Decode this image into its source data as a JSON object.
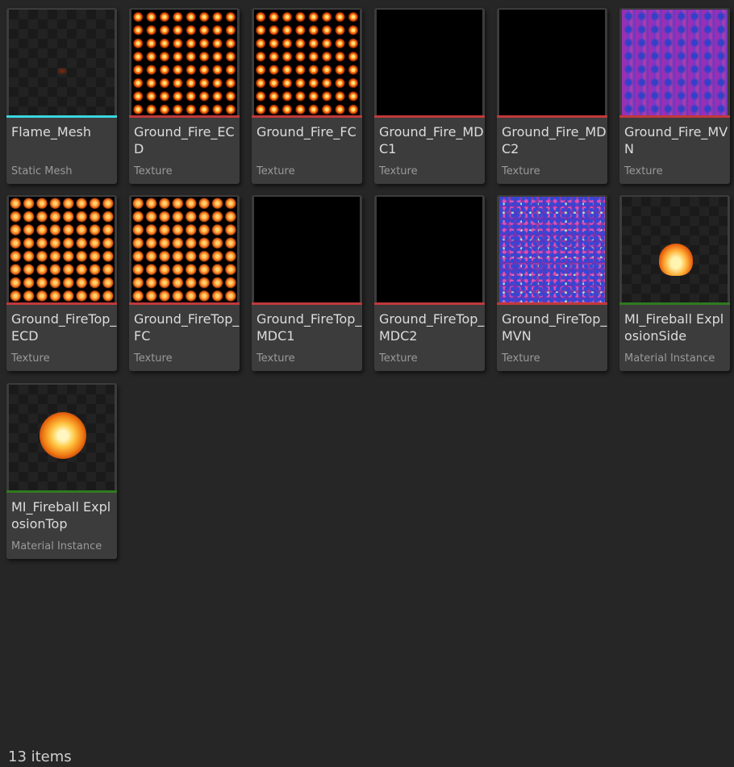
{
  "colors": {
    "background": "#262626",
    "tile": "#3c3c3c",
    "static_mesh_bar": "#3ad6e0",
    "texture_bar": "#c0393b",
    "material_instance_bar": "#2f7a1f"
  },
  "assets": [
    {
      "name": "Flame_Mesh",
      "type": "Static Mesh",
      "thumbnail": "flame-mesh-preview"
    },
    {
      "name": "Ground_Fire_ECD",
      "type": "Texture",
      "thumbnail": "fire-flipbook"
    },
    {
      "name": "Ground_Fire_FC",
      "type": "Texture",
      "thumbnail": "fire-flipbook"
    },
    {
      "name": "Ground_Fire_MDC1",
      "type": "Texture",
      "thumbnail": "black"
    },
    {
      "name": "Ground_Fire_MDC2",
      "type": "Texture",
      "thumbnail": "black"
    },
    {
      "name": "Ground_Fire_MVN",
      "type": "Texture",
      "thumbnail": "motion-vector-flipbook"
    },
    {
      "name": "Ground_FireTop_ECD",
      "type": "Texture",
      "thumbnail": "fire-top-flipbook"
    },
    {
      "name": "Ground_FireTop_FC",
      "type": "Texture",
      "thumbnail": "fire-top-flipbook"
    },
    {
      "name": "Ground_FireTop_MDC1",
      "type": "Texture",
      "thumbnail": "black"
    },
    {
      "name": "Ground_FireTop_MDC2",
      "type": "Texture",
      "thumbnail": "black"
    },
    {
      "name": "Ground_FireTop_MVN",
      "type": "Texture",
      "thumbnail": "motion-vector-noise"
    },
    {
      "name": "MI_Fireball ExplosionSide",
      "type": "Material Instance",
      "thumbnail": "fireball-side-preview"
    },
    {
      "name": "MI_Fireball ExplosionTop",
      "type": "Material Instance",
      "thumbnail": "fireball-top-preview"
    }
  ],
  "footer": {
    "item_count": "13 items"
  }
}
